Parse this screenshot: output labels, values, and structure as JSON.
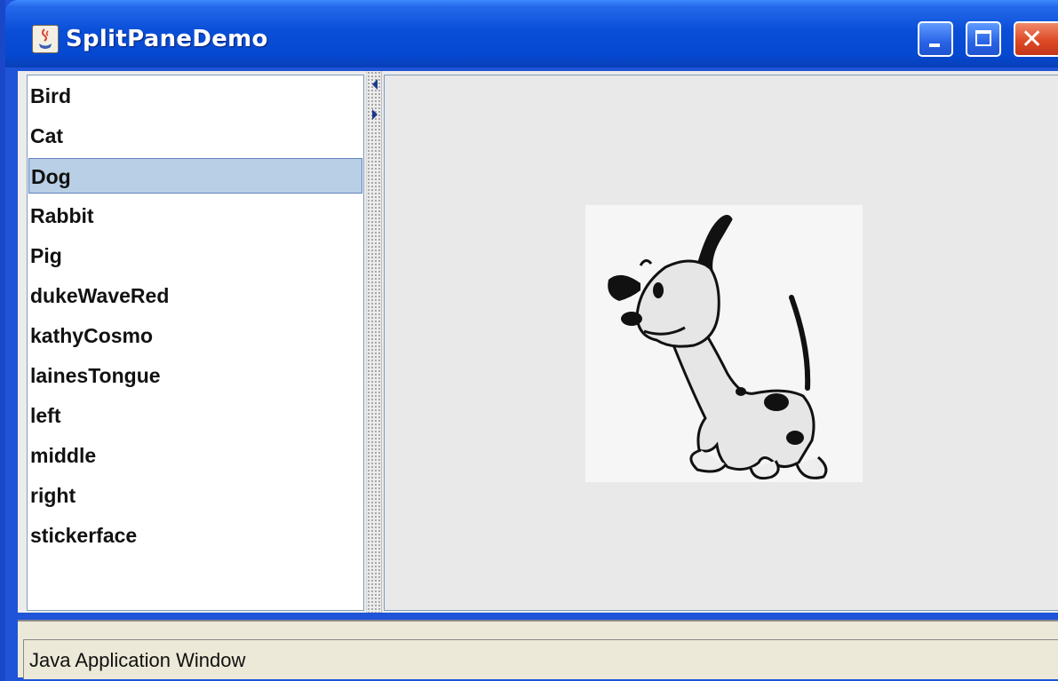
{
  "window": {
    "title": "SplitPaneDemo"
  },
  "titlebar": {
    "app_icon": "java-cup-icon",
    "buttons": [
      "minimize-icon",
      "maximize-icon",
      "close-icon"
    ]
  },
  "list": {
    "items": [
      "Bird",
      "Cat",
      "Dog",
      "Rabbit",
      "Pig",
      "dukeWaveRed",
      "kathyCosmo",
      "lainesTongue",
      "left",
      "middle",
      "right",
      "stickerface"
    ],
    "selected": "Dog"
  },
  "image_pane": {
    "image": "dog-cartoon-image"
  },
  "statusbar": {
    "text": "Java Application Window"
  },
  "colors": {
    "titlebar": "#0548d2",
    "selection": "#b8cfe5",
    "close_button": "#dd4a25"
  }
}
